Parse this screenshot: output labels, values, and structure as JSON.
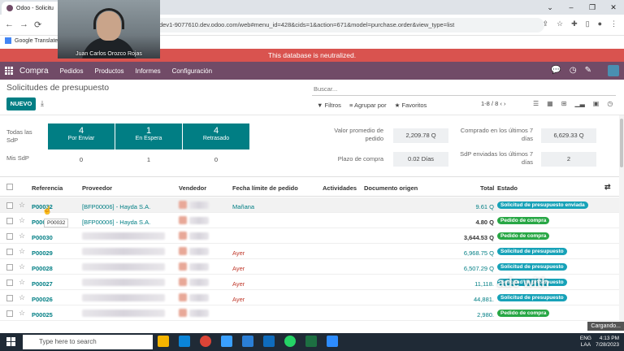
{
  "browser": {
    "tab_title": "Odoo - Solicitu",
    "url": "dev1-9077610.dev.odoo.com/web#menu_id=428&cids=1&action=671&model=purchase.order&view_type=list",
    "bookmark": "Google Translate"
  },
  "webcam": {
    "name": "Juan Carlos Orozco Rojas"
  },
  "banner": "This database is neutralized.",
  "navbar": {
    "app_name": "Compra",
    "menus": [
      "Pedidos",
      "Productos",
      "Informes",
      "Configuración"
    ]
  },
  "control_panel": {
    "title": "Solicitudes de presupuesto",
    "new_label": "NUEVO",
    "search_placeholder": "Buscar...",
    "filters_label": "Filtros",
    "group_label": "Agrupar por",
    "favorites_label": "Favoritos",
    "pager": "1-8 / 8"
  },
  "dashboard": {
    "all_label": "Todas las SdP",
    "mine_label": "Mis SdP",
    "tiles": [
      {
        "count": "4",
        "label": "Por Enviar",
        "mine": "0"
      },
      {
        "count": "1",
        "label": "En Espera",
        "mine": "1"
      },
      {
        "count": "4",
        "label": "Retrasado",
        "mine": "0"
      }
    ],
    "kpis": [
      {
        "label": "Valor promedio de pedido",
        "value": "2,209.78 Q"
      },
      {
        "label": "Plazo de compra",
        "value": "0.02 Días"
      },
      {
        "label": "Comprado en los últimos 7 días",
        "value": "6,629.33 Q"
      },
      {
        "label": "SdP enviadas los últimos 7 días",
        "value": "2"
      }
    ]
  },
  "table": {
    "headers": {
      "ref": "Referencia",
      "supplier": "Proveedor",
      "buyer": "Vendedor",
      "deadline": "Fecha límite de pedido",
      "activities": "Actividades",
      "origin": "Documento origen",
      "total": "Total",
      "status": "Estado"
    },
    "rows": [
      {
        "ref": "P00032",
        "supplier": "[BFP00006] - Hayda S.A.",
        "deadline": "Mañana",
        "total": "9.61 Q",
        "status": "Solicitud de presupuesto enviada"
      },
      {
        "ref": "P0003",
        "supplier": "[BFP00006] - Hayda S.A.",
        "deadline": "",
        "total": "4.80 Q",
        "status": "Pedido de compra"
      },
      {
        "ref": "P00030",
        "supplier": "",
        "deadline": "",
        "total": "3,644.53 Q",
        "status": "Pedido de compra"
      },
      {
        "ref": "P00029",
        "supplier": "",
        "deadline": "Ayer",
        "total": "6,968.75 Q",
        "status": "Solicitud de presupuesto"
      },
      {
        "ref": "P00028",
        "supplier": "",
        "deadline": "Ayer",
        "total": "6,507.29 Q",
        "status": "Solicitud de presupuesto"
      },
      {
        "ref": "P00027",
        "supplier": "",
        "deadline": "Ayer",
        "total": "11,118.",
        "status": "Solicitud de presupuesto"
      },
      {
        "ref": "P00026",
        "supplier": "",
        "deadline": "Ayer",
        "total": "44,881.",
        "status": "Solicitud de presupuesto"
      },
      {
        "ref": "P00025",
        "supplier": "",
        "deadline": "",
        "total": "2,980.",
        "status": "Pedido de compra"
      }
    ],
    "tooltip": "P00032"
  },
  "watermark": "ade with",
  "loading": "Cargando...",
  "taskbar": {
    "search_placeholder": "Type here to search",
    "lang_top": "ENG",
    "lang_bottom": "LAA",
    "time": "4:13 PM",
    "date": "7/28/2023"
  }
}
